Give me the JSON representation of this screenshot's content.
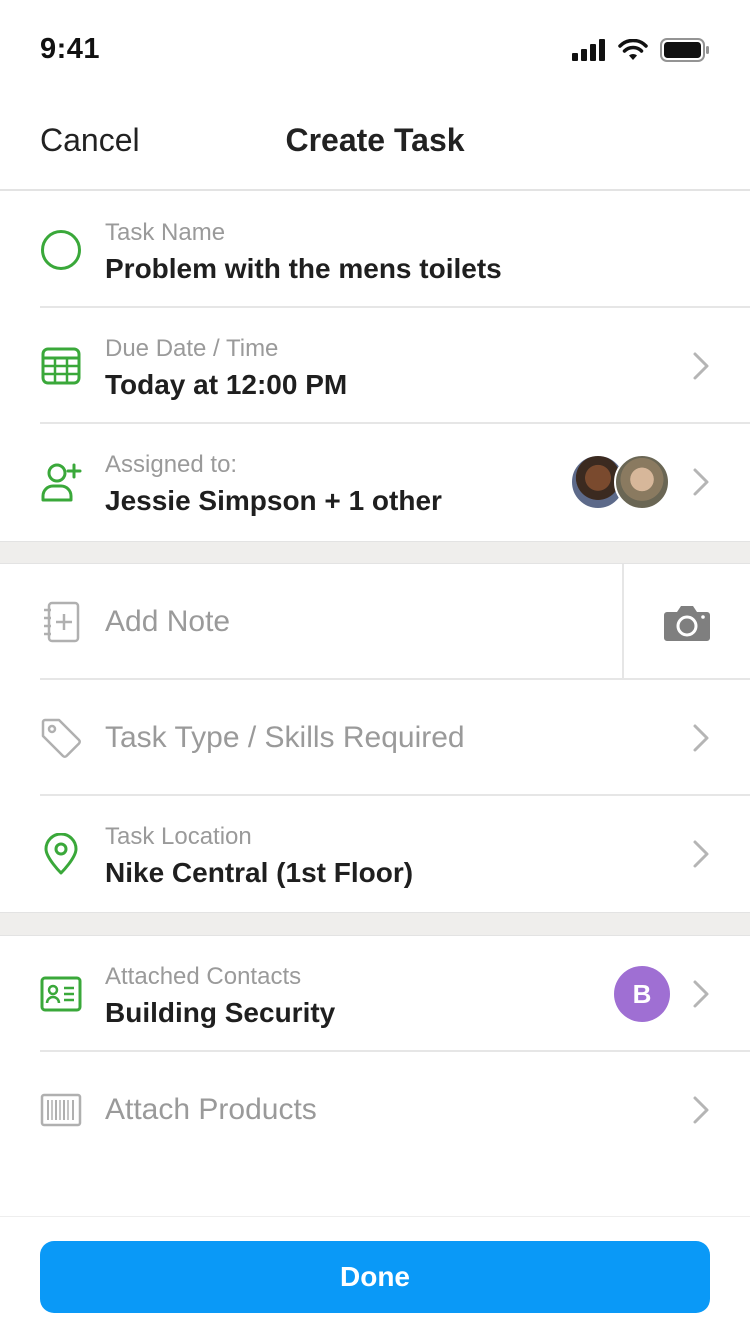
{
  "status_bar": {
    "time": "9:41"
  },
  "nav": {
    "cancel_label": "Cancel",
    "title": "Create Task"
  },
  "fields": {
    "task_name": {
      "label": "Task Name",
      "value": "Problem with the mens toilets"
    },
    "due_date": {
      "label": "Due Date / Time",
      "value": "Today at 12:00 PM"
    },
    "assigned": {
      "label": "Assigned to:",
      "value": "Jessie Simpson + 1 other"
    },
    "note": {
      "placeholder": "Add Note"
    },
    "task_type": {
      "placeholder": "Task Type / Skills Required"
    },
    "location": {
      "label": "Task Location",
      "value": "Nike Central (1st Floor)"
    },
    "contacts": {
      "label": "Attached Contacts",
      "value": "Building Security",
      "badge_initial": "B"
    },
    "products": {
      "placeholder": "Attach Products"
    }
  },
  "footer": {
    "done_label": "Done"
  },
  "colors": {
    "accent_green": "#3aa83a",
    "primary_blue": "#0a99f7",
    "badge_purple": "#9f6fd3",
    "muted_gray": "#9a9a9a"
  },
  "icons": [
    "cellular-icon",
    "wifi-icon",
    "battery-icon",
    "circle-check-icon",
    "calendar-icon",
    "user-add-icon",
    "note-icon",
    "camera-icon",
    "tag-icon",
    "location-pin-icon",
    "contact-card-icon",
    "barcode-icon",
    "chevron-right-icon"
  ]
}
